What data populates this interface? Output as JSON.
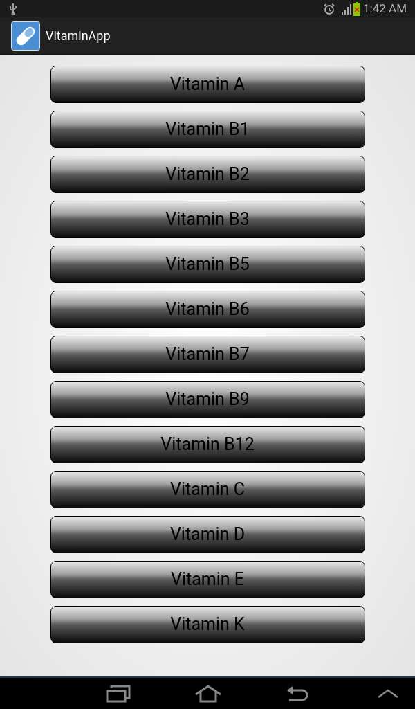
{
  "status_bar": {
    "time": "1:42 AM"
  },
  "action_bar": {
    "title": "VitaminApp"
  },
  "buttons": [
    {
      "label": "Vitamin A"
    },
    {
      "label": "Vitamin B1"
    },
    {
      "label": "Vitamin B2"
    },
    {
      "label": "Vitamin B3"
    },
    {
      "label": "Vitamin B5"
    },
    {
      "label": "Vitamin B6"
    },
    {
      "label": "Vitamin B7"
    },
    {
      "label": "Vitamin B9"
    },
    {
      "label": "Vitamin B12"
    },
    {
      "label": "Vitamin C"
    },
    {
      "label": "Vitamin D"
    },
    {
      "label": "Vitamin E"
    },
    {
      "label": "Vitamin K"
    }
  ]
}
